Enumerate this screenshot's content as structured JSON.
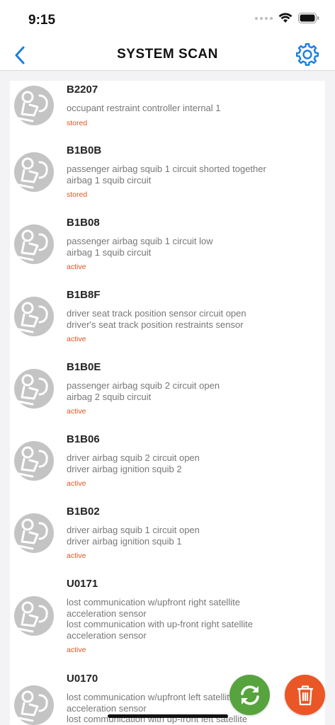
{
  "status_bar": {
    "time": "9:15"
  },
  "nav": {
    "title": "SYSTEM SCAN",
    "back_icon": "chevron-left-icon",
    "settings_icon": "gear-icon"
  },
  "colors": {
    "accent": "#1a7fe0",
    "status_text": "#e0541f",
    "refresh_button": "#57a33d",
    "delete_button": "#ea5626"
  },
  "dtc_items": [
    {
      "code": "B2207",
      "description": [
        "occupant restraint controller internal 1"
      ],
      "status": "stored"
    },
    {
      "code": "B1B0B",
      "description": [
        "passenger airbag squib 1 circuit shorted together",
        "airbag 1 squib circuit"
      ],
      "status": "stored"
    },
    {
      "code": "B1B08",
      "description": [
        "passenger airbag squib 1 circuit low",
        "airbag 1 squib circuit"
      ],
      "status": "active"
    },
    {
      "code": "B1B8F",
      "description": [
        "driver seat track position sensor circuit open",
        "driver's seat track position restraints sensor"
      ],
      "status": "active"
    },
    {
      "code": "B1B0E",
      "description": [
        "passenger airbag squib 2 circuit open",
        "airbag 2 squib circuit"
      ],
      "status": "active"
    },
    {
      "code": "B1B06",
      "description": [
        "driver airbag squib 2 circuit open",
        "driver airbag ignition squib 2"
      ],
      "status": "active"
    },
    {
      "code": "B1B02",
      "description": [
        "driver airbag squib 1 circuit open",
        "driver airbag ignition squib 1"
      ],
      "status": "active"
    },
    {
      "code": "U0171",
      "description": [
        "lost communication w/upfront right satellite",
        "acceleration sensor",
        "lost communication with up-front right satellite",
        "acceleration sensor"
      ],
      "status": "active"
    },
    {
      "code": "U0170",
      "description": [
        "lost communication w/upfront left satellite",
        "acceleration sensor",
        "lost communication with up-front left satellite"
      ],
      "status": ""
    }
  ],
  "actions": {
    "refresh_icon": "refresh-icon",
    "delete_icon": "trash-icon"
  }
}
